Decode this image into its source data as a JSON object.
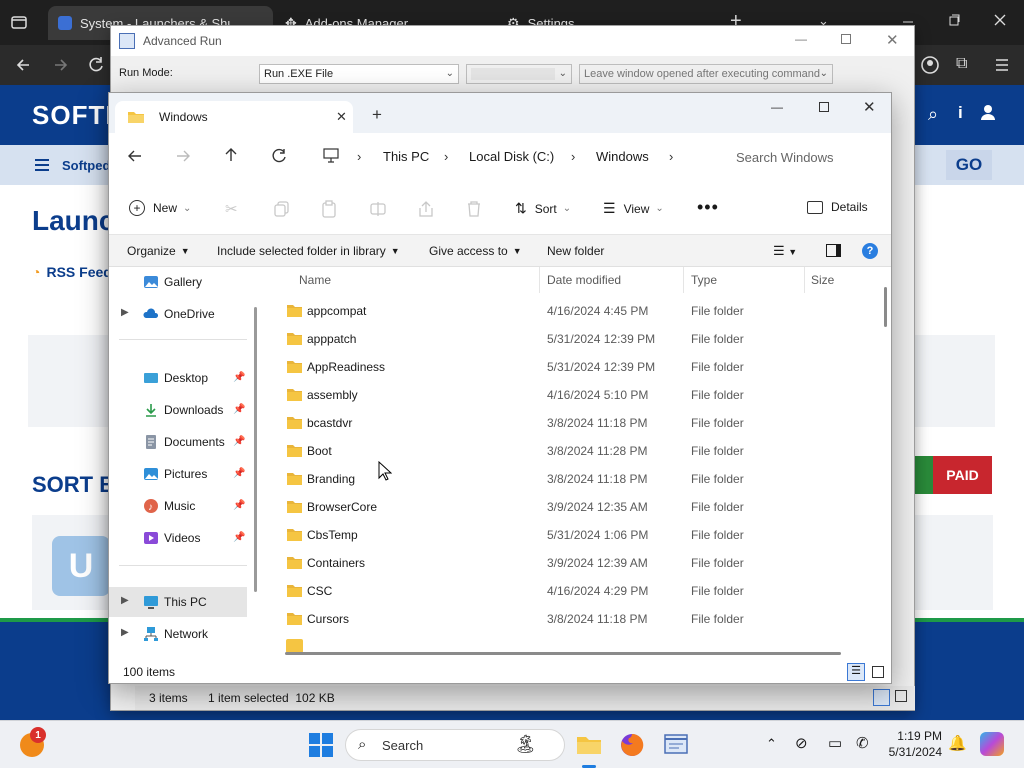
{
  "browser": {
    "tabs": [
      {
        "label": "System - Launchers & Shutdow"
      },
      {
        "label": "Add-ons Manager"
      },
      {
        "label": "Settings"
      }
    ]
  },
  "softpedia": {
    "logo": "SOFTI",
    "nav_label": "Softpedi",
    "go_label": "GO",
    "heading": "Launch",
    "rss_label": "RSS Feed",
    "sort_label": "SORT BY",
    "paid_label": "PAID"
  },
  "advanced_run": {
    "title": "Advanced Run",
    "run_mode_label": "Run Mode:",
    "run_mode_value": "Run .EXE File",
    "option_value": "Leave window opened after executing command",
    "status": {
      "items": "3 items",
      "selected": "1 item selected  102 KB"
    }
  },
  "explorer": {
    "tab_title": "Windows",
    "breadcrumb": [
      "This PC",
      "Local Disk (C:)",
      "Windows"
    ],
    "search_placeholder": "Search Windows",
    "toolbar": {
      "new": "New",
      "sort": "Sort",
      "view": "View",
      "details": "Details"
    },
    "commands": {
      "organize": "Organize",
      "include": "Include selected folder in library",
      "give_access": "Give access to",
      "new_folder": "New folder"
    },
    "nav": [
      {
        "label": "Gallery",
        "icon": "gallery-icon"
      },
      {
        "label": "OneDrive",
        "icon": "cloud-icon"
      },
      {
        "label": "Desktop",
        "icon": "desktop-icon"
      },
      {
        "label": "Downloads",
        "icon": "download-icon"
      },
      {
        "label": "Documents",
        "icon": "document-icon"
      },
      {
        "label": "Pictures",
        "icon": "picture-icon"
      },
      {
        "label": "Music",
        "icon": "music-icon"
      },
      {
        "label": "Videos",
        "icon": "video-icon"
      },
      {
        "label": "This PC",
        "icon": "computer-icon"
      },
      {
        "label": "Network",
        "icon": "network-icon"
      }
    ],
    "columns": [
      "Name",
      "Date modified",
      "Type",
      "Size"
    ],
    "files": [
      {
        "name": "appcompat",
        "date": "4/16/2024 4:45 PM",
        "type": "File folder"
      },
      {
        "name": "apppatch",
        "date": "5/31/2024 12:39 PM",
        "type": "File folder"
      },
      {
        "name": "AppReadiness",
        "date": "5/31/2024 12:39 PM",
        "type": "File folder"
      },
      {
        "name": "assembly",
        "date": "4/16/2024 5:10 PM",
        "type": "File folder"
      },
      {
        "name": "bcastdvr",
        "date": "3/8/2024 11:18 PM",
        "type": "File folder"
      },
      {
        "name": "Boot",
        "date": "3/8/2024 11:28 PM",
        "type": "File folder"
      },
      {
        "name": "Branding",
        "date": "3/8/2024 11:18 PM",
        "type": "File folder"
      },
      {
        "name": "BrowserCore",
        "date": "3/9/2024 12:35 AM",
        "type": "File folder"
      },
      {
        "name": "CbsTemp",
        "date": "5/31/2024 1:06 PM",
        "type": "File folder"
      },
      {
        "name": "Containers",
        "date": "3/9/2024 12:39 AM",
        "type": "File folder"
      },
      {
        "name": "CSC",
        "date": "4/16/2024 4:29 PM",
        "type": "File folder"
      },
      {
        "name": "Cursors",
        "date": "3/8/2024 11:18 PM",
        "type": "File folder"
      }
    ],
    "status_items": "100 items"
  },
  "taskbar": {
    "search_label": "Search",
    "time": "1:19 PM",
    "date": "5/31/2024",
    "badge": "1"
  },
  "colors": {
    "accent": "#0b3d8c",
    "paid": "#c8262e",
    "folder": "#f5c542"
  }
}
